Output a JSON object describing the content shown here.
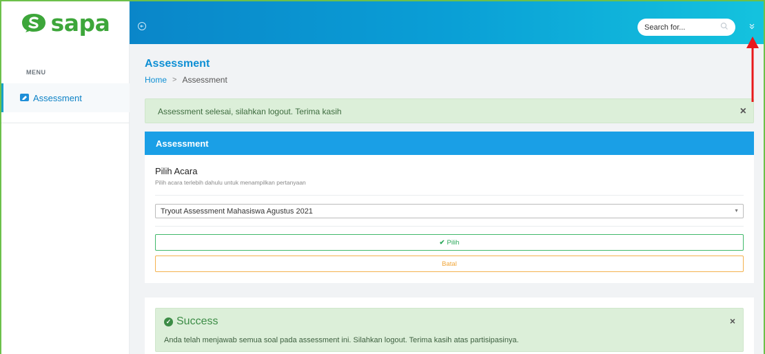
{
  "brand": {
    "name": "sapa",
    "color": "#3da63a"
  },
  "header": {
    "search_placeholder": "Search for...",
    "gradient_start": "#0a86c9",
    "gradient_end": "#14c3de"
  },
  "sidebar": {
    "menu_title": "MENU",
    "items": [
      {
        "label": "Assessment",
        "icon": "edit-icon",
        "active": true
      }
    ]
  },
  "page": {
    "title": "Assessment",
    "breadcrumb": {
      "home": "Home",
      "current": "Assessment"
    }
  },
  "alert_top": {
    "message": "Assessment selesai, silahkan logout. Terima kasih",
    "close": "×"
  },
  "card": {
    "header": "Assessment",
    "section_title": "Pilih Acara",
    "section_desc": "Pilih acara terlebih dahulu untuk menampilkan pertanyaan",
    "select_value": "Tryout Assessment Mahasiswa Agustus 2021",
    "btn_pilih": "Pilih",
    "btn_batal": "Batal"
  },
  "success_alert": {
    "title": "Success",
    "message": "Anda telah menjawab semua soal pada assessment ini. Silahkan logout. Terima kasih atas partisipasinya.",
    "close": "×"
  },
  "colors": {
    "accent": "#1a9fe6",
    "success_bg": "#dcefd9",
    "success_text": "#3c8c46",
    "warning": "#f0a63a",
    "annotation": "#e8191b"
  }
}
